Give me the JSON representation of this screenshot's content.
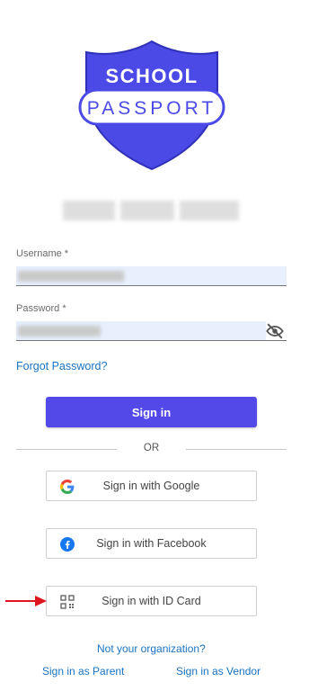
{
  "logo": {
    "line1": "SCHOOL",
    "line2": "PASSPORT",
    "brand_color": "#4b4ae6"
  },
  "organization": {
    "name": ""
  },
  "login_form": {
    "username_label": "Username *",
    "password_label": "Password *",
    "password_visibility_icon": "eye-off-icon",
    "forgot_password": "Forgot Password?",
    "sign_in_label": "Sign in",
    "divider": "OR"
  },
  "oauth": {
    "google_label": "Sign in with Google",
    "facebook_label": "Sign in with Facebook",
    "idcard_label": "Sign in with ID Card"
  },
  "footer": {
    "not_org": "Not your organization?",
    "parent": "Sign in as Parent",
    "vendor": "Sign in as Vendor"
  },
  "colors": {
    "primary": "#5349e8",
    "link": "#1a73c2",
    "annotation_arrow": "#e0161e"
  }
}
